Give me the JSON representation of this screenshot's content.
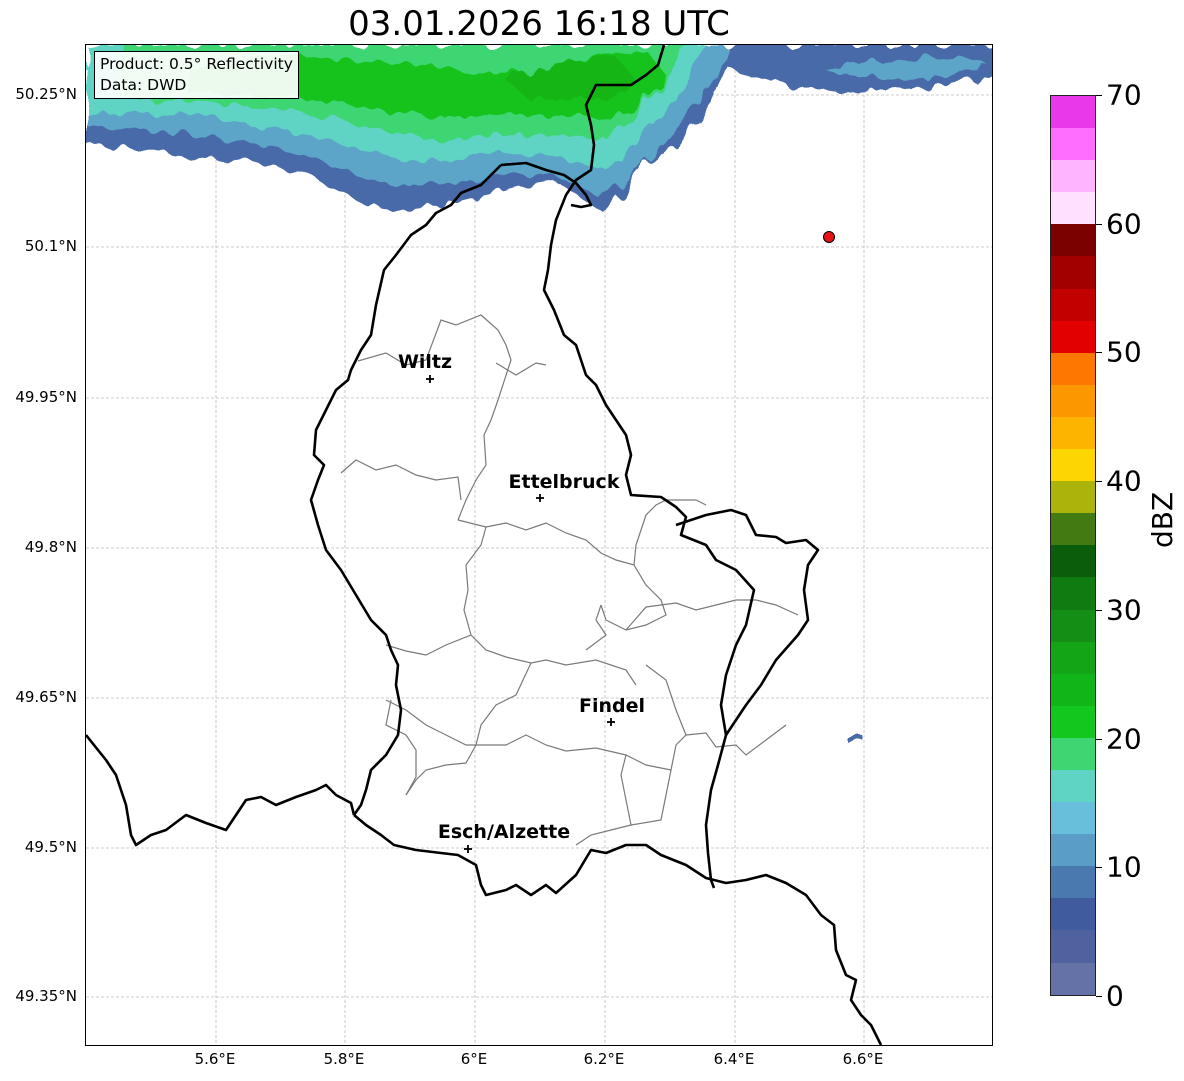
{
  "title": "03.01.2026 16:18 UTC",
  "info": {
    "product": "Product: 0.5° Reflectivity",
    "data": "Data: DWD"
  },
  "lat_ticks": [
    "50.25°N",
    "50.1°N",
    "49.95°N",
    "49.8°N",
    "49.65°N",
    "49.5°N",
    "49.35°N"
  ],
  "lon_ticks": [
    "5.6°E",
    "5.8°E",
    "6°E",
    "6.2°E",
    "6.4°E",
    "6.6°E"
  ],
  "cities": [
    {
      "name": "Wiltz",
      "lon": 5.93,
      "lat": 49.966
    },
    {
      "name": "Ettelbruck",
      "lon": 6.1,
      "lat": 49.847
    },
    {
      "name": "Findel",
      "lon": 6.21,
      "lat": 49.627
    },
    {
      "name": "Esch/Alzette",
      "lon": 5.99,
      "lat": 49.5
    }
  ],
  "radar_site": {
    "lon": 6.548,
    "lat": 50.11,
    "color": "#e8121b"
  },
  "colorbar": {
    "label": "dBZ",
    "ticks": [
      "0",
      "10",
      "20",
      "30",
      "40",
      "50",
      "60",
      "70"
    ],
    "colors": [
      "#6472a8",
      "#4f629f",
      "#415c9e",
      "#4a79b0",
      "#5a9ec8",
      "#68bfdc",
      "#5fd4c4",
      "#3ed672",
      "#12c81e",
      "#12b518",
      "#14a516",
      "#148e15",
      "#107b10",
      "#0b5d0b",
      "#437a12",
      "#acb30a",
      "#fdd500",
      "#fdb400",
      "#fd9700",
      "#fd7800",
      "#e20000",
      "#c20000",
      "#a20000",
      "#7b0000",
      "#ffe0ff",
      "#ffb4ff",
      "#ff6eff",
      "#e838e8"
    ]
  }
}
